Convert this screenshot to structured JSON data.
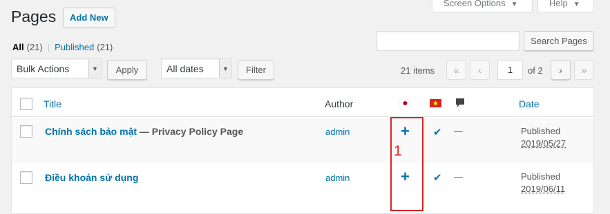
{
  "screen_options": {
    "label": "Screen Options"
  },
  "help": {
    "label": "Help"
  },
  "page": {
    "title": "Pages",
    "add_new": "Add New"
  },
  "filters": {
    "all_label": "All",
    "all_count": "(21)",
    "published_label": "Published",
    "published_count": "(21)"
  },
  "search": {
    "button": "Search Pages",
    "value": ""
  },
  "bulk": {
    "select": "Bulk Actions",
    "apply": "Apply"
  },
  "dates": {
    "select": "All dates",
    "filter": "Filter"
  },
  "pagination": {
    "items": "21 items",
    "first": "«",
    "prev": "‹",
    "current": "1",
    "of": "of 2",
    "next": "›",
    "last": "»"
  },
  "table": {
    "headers": {
      "title": "Title",
      "author": "Author",
      "date": "Date"
    },
    "rows": [
      {
        "title": "Chính sách bảo mật",
        "state": " — Privacy Policy Page",
        "author": "admin",
        "status": "Published",
        "date": "2019/05/27"
      },
      {
        "title": "Điều khoản sử dụng",
        "state": "",
        "author": "admin",
        "status": "Published",
        "date": "2019/06/11"
      }
    ]
  },
  "annotation": {
    "number": "1"
  },
  "colors": {
    "link": "#0073aa",
    "annotation": "#e02020",
    "flag_vn": "#da251d",
    "flag_jp_dot": "#bc002d"
  },
  "icons": {
    "lang_jp": "flag-jp-icon",
    "lang_vn": "flag-vn-icon",
    "comments": "comment-bubble-icon",
    "add_translation": "plus-icon",
    "translation_done": "checkmark-icon"
  }
}
